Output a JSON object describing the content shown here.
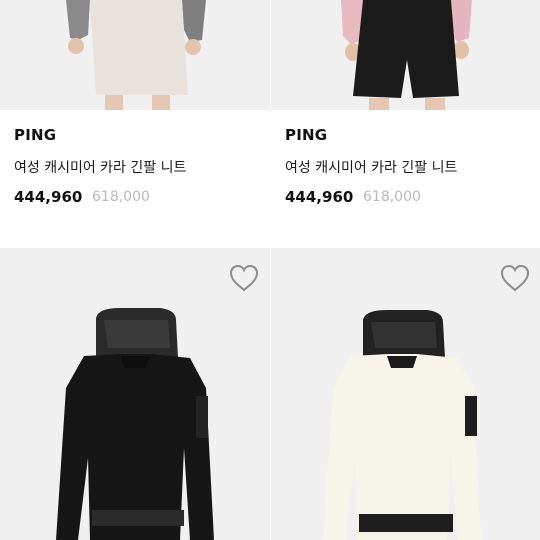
{
  "products": [
    {
      "brand": "PING",
      "name": "여성 캐시미어 카라 긴팔 니트",
      "price": "444,960",
      "original_price": "618,000",
      "image": "cream-knit-skirt-model"
    },
    {
      "brand": "PING",
      "name": "여성 캐시미어 카라 긴팔 니트",
      "price": "444,960",
      "original_price": "618,000",
      "image": "black-shorts-model"
    },
    {
      "image": "black-hooded-jacket",
      "wishlist_icon": "heart-outline-icon"
    },
    {
      "image": "white-hooded-jacket",
      "wishlist_icon": "heart-outline-icon"
    }
  ],
  "colors": {
    "image_bg": "#f0f0f0",
    "text": "#111111",
    "original_price": "#b9b9b9"
  }
}
